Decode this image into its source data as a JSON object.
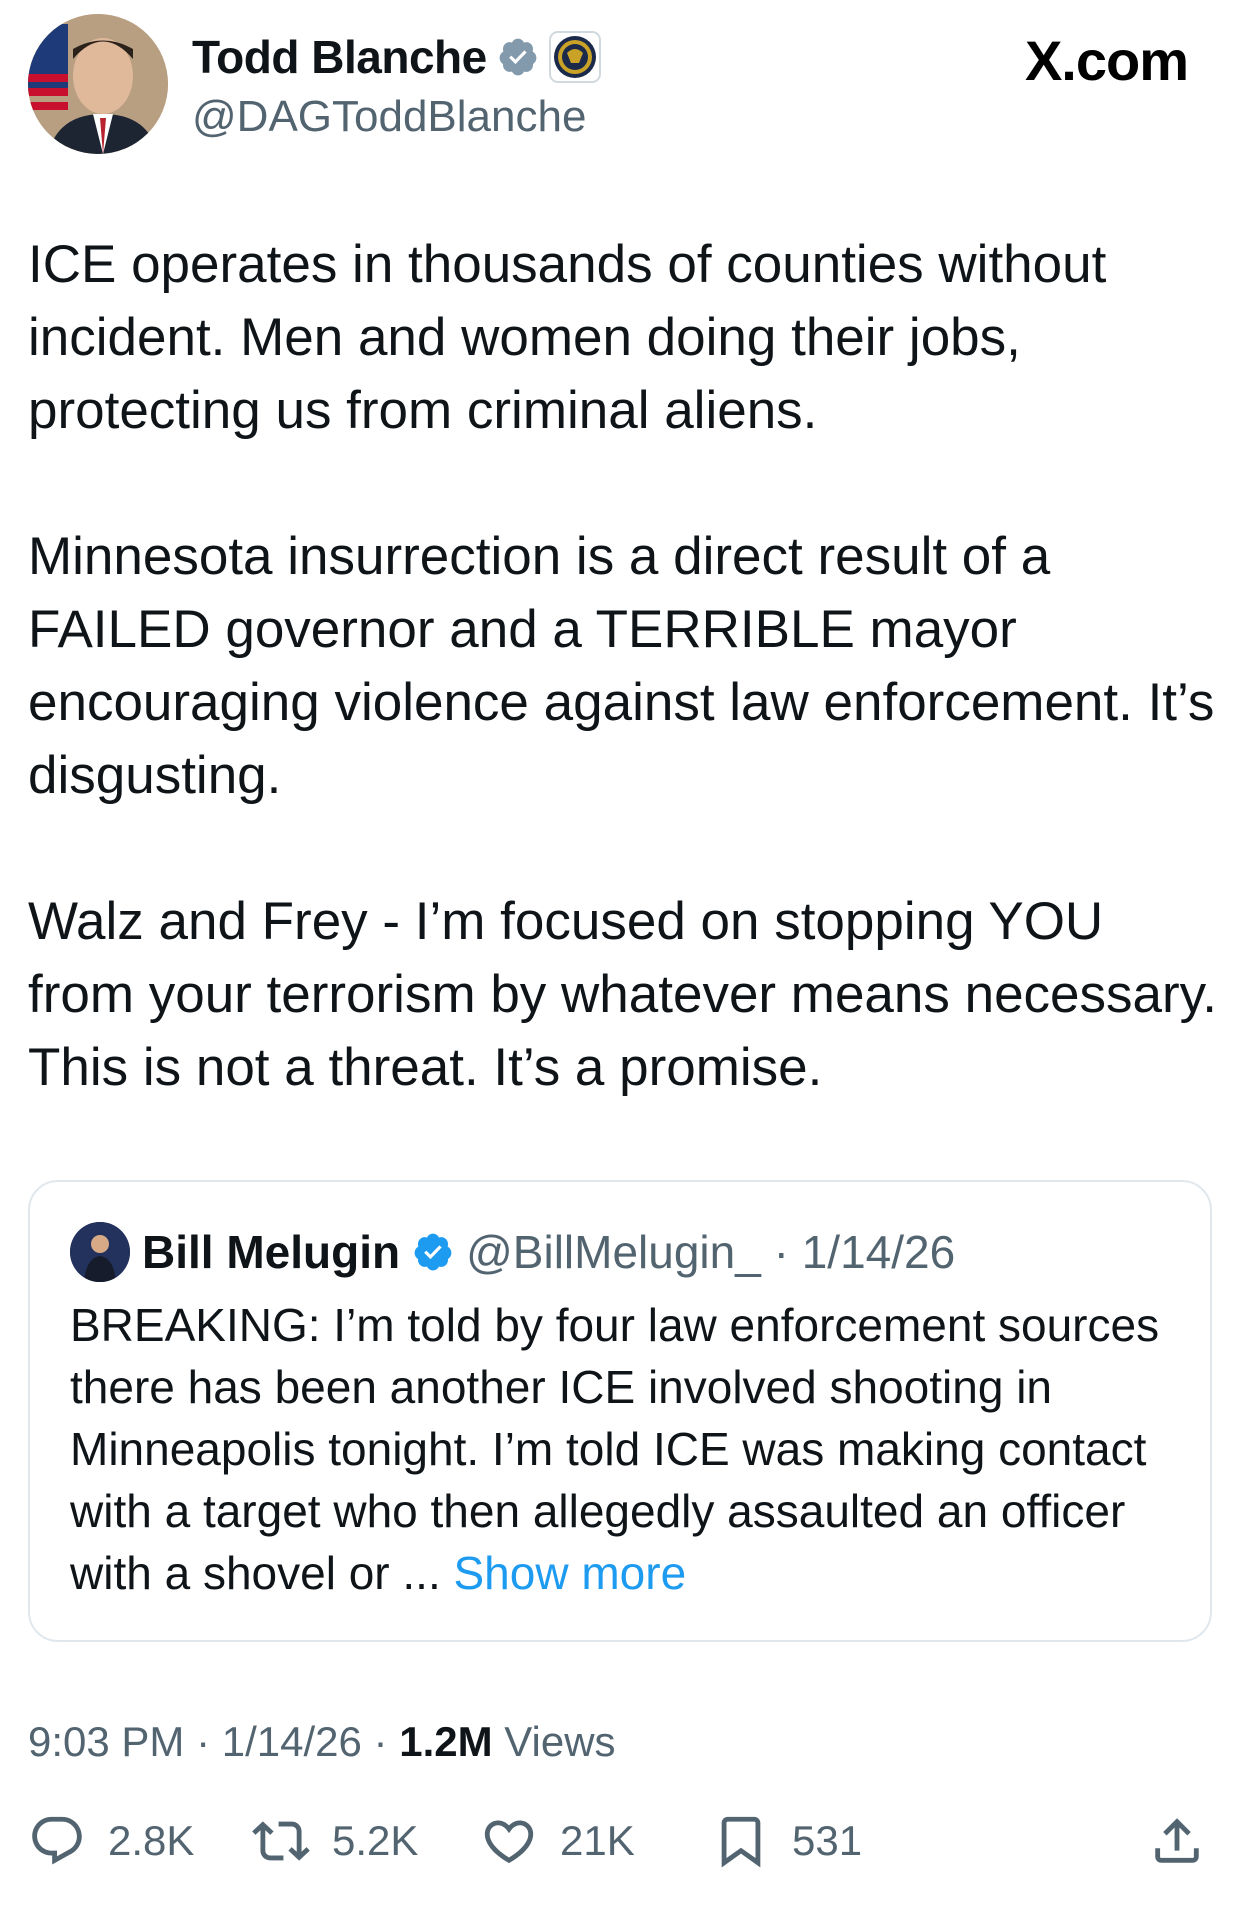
{
  "author": {
    "name": "Todd Blanche",
    "handle": "@DAGToddBlanche"
  },
  "site": "X.com",
  "tweet_text": "ICE operates in thousands of counties without incident. Men and women doing their jobs, protecting us from criminal aliens.\n\nMinnesota insurrection is a direct result of a FAILED governor and a TERRIBLE mayor encouraging violence against law enforcement. It’s disgusting.\n\nWalz and Frey - I’m focused on stopping YOU from your terrorism by whatever means necessary. This is not a threat. It’s a promise.",
  "quote": {
    "name": "Bill Melugin",
    "handle": "@BillMelugin_",
    "separator": " · ",
    "date": "1/14/26",
    "text": "BREAKING: I’m told by four law enforcement sources there has been another ICE involved shooting in Minneapolis tonight. I’m told ICE was making contact with a target who then allegedly assaulted an officer with a shovel or ... ",
    "show_more": "Show more"
  },
  "meta": {
    "time": "9:03 PM",
    "sep1": " · ",
    "date": "1/14/26",
    "sep2": " · ",
    "views_count": "1.2M",
    "views_label": " Views"
  },
  "actions": {
    "replies": "2.8K",
    "reposts": "5.2K",
    "likes": "21K",
    "bookmarks": "531"
  },
  "colors": {
    "link": "#1d9bf0",
    "secondary_text": "#536471",
    "verified": "#1d9bf0"
  }
}
